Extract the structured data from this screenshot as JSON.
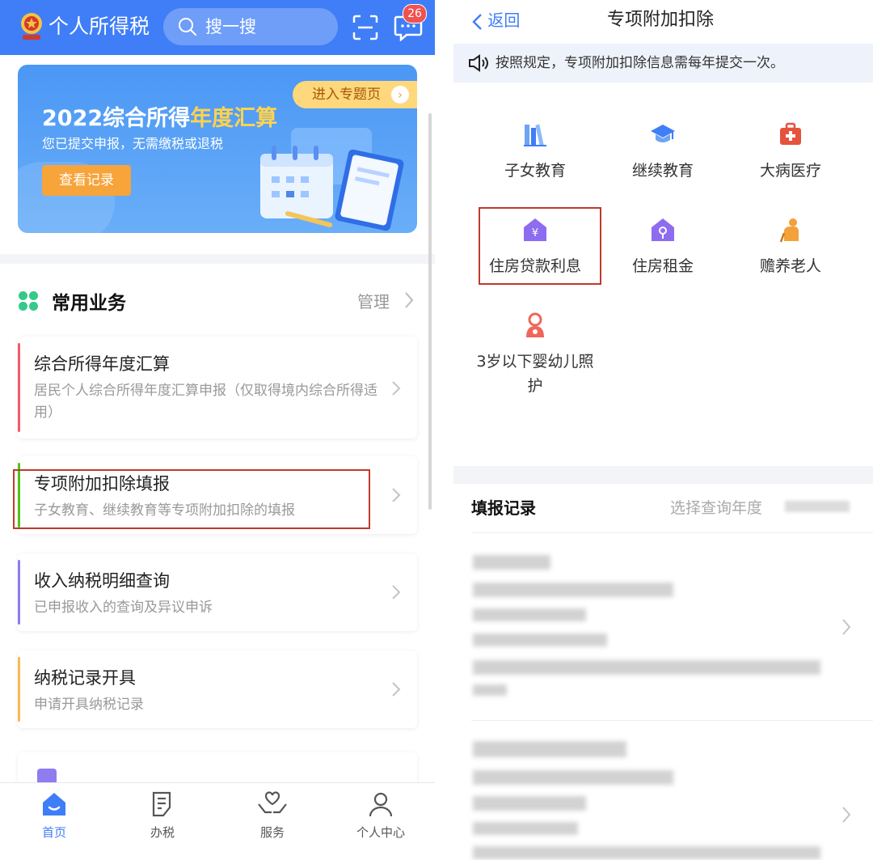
{
  "left_app": {
    "header": {
      "title": "个人所得税",
      "search_placeholder": "搜一搜",
      "message_badge": "26"
    },
    "banner": {
      "title_prefix": "2022综合所得",
      "title_highlight": "年度汇算",
      "subtitle": "您已提交申报，无需缴税或退税",
      "button": "查看记录",
      "tag": "进入专题页"
    },
    "section": {
      "title": "常用业务",
      "manage": "管理"
    },
    "cards": [
      {
        "title": "综合所得年度汇算",
        "subtitle": "居民个人综合所得年度汇算申报（仅取得境内综合所得适用）",
        "accent": "#f15b6c"
      },
      {
        "title": "专项附加扣除填报",
        "subtitle": "子女教育、继续教育等专项附加扣除的填报",
        "accent": "#52c41a"
      },
      {
        "title": "收入纳税明细查询",
        "subtitle": "已申报收入的查询及异议申诉",
        "accent": "#8e7cf0"
      },
      {
        "title": "纳税记录开具",
        "subtitle": "申请开具纳税记录",
        "accent": "#f7b955"
      }
    ],
    "tabbar": [
      {
        "label": "首页",
        "icon": "home-icon",
        "active": true
      },
      {
        "label": "办税",
        "icon": "document-edit-icon",
        "active": false
      },
      {
        "label": "服务",
        "icon": "heart-hands-icon",
        "active": false
      },
      {
        "label": "个人中心",
        "icon": "user-icon",
        "active": false
      }
    ],
    "colors": {
      "primary": "#3f7ef7",
      "highlight_box": "#c0392b"
    }
  },
  "right_app": {
    "header": {
      "back": "返回",
      "title": "专项附加扣除"
    },
    "notice": "按照规定，专项附加扣除信息需每年提交一次。",
    "items": [
      {
        "label": "子女教育",
        "icon": "books-icon"
      },
      {
        "label": "继续教育",
        "icon": "graduation-cap-icon"
      },
      {
        "label": "大病医疗",
        "icon": "medical-kit-icon"
      },
      {
        "label": "住房贷款利息",
        "icon": "house-yuan-icon"
      },
      {
        "label": "住房租金",
        "icon": "house-key-icon"
      },
      {
        "label": "赡养老人",
        "icon": "elder-icon"
      },
      {
        "label": "3岁以下婴幼儿照护",
        "icon": "mother-baby-icon"
      }
    ],
    "records": {
      "title": "填报记录",
      "filter": "选择查询年度"
    }
  }
}
